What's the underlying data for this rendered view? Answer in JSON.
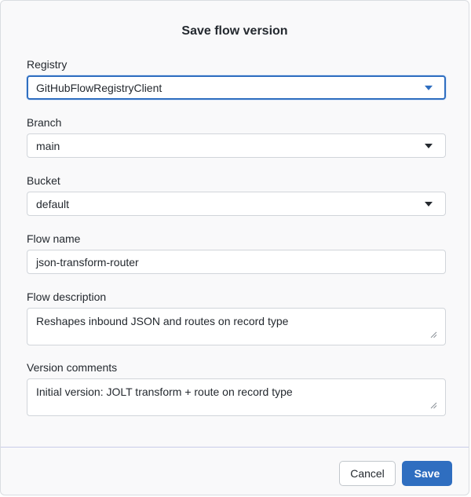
{
  "dialog": {
    "title": "Save flow version"
  },
  "registry": {
    "label": "Registry",
    "selected": "GitHubFlowRegistryClient"
  },
  "branch": {
    "label": "Branch",
    "selected": "main"
  },
  "bucket": {
    "label": "Bucket",
    "selected": "default"
  },
  "flow_name": {
    "label": "Flow name",
    "value": "json-transform-router"
  },
  "flow_description": {
    "label": "Flow description",
    "value": "Reshapes inbound JSON and routes on record type"
  },
  "version_comments": {
    "label": "Version comments",
    "value": "Initial version: JOLT transform + route on record type"
  },
  "actions": {
    "cancel_label": "Cancel",
    "save_label": "Save"
  },
  "colors": {
    "accent": "#2f6ec0",
    "border": "#d1d5da",
    "dialog_bg": "#f9f9fa"
  }
}
